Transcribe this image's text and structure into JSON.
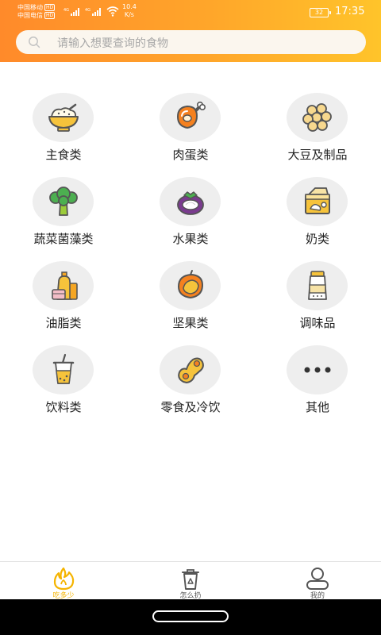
{
  "status_bar": {
    "carrier1": "中国移动",
    "carrier2": "中国电信",
    "hd": "HD",
    "net_type": "4G",
    "speed_value": "10.4",
    "speed_unit": "K/s",
    "battery": "32",
    "time": "17:35"
  },
  "search": {
    "placeholder": "请输入想要查询的食物",
    "icon": "search-icon"
  },
  "categories": [
    {
      "label": "主食类",
      "icon": "rice-bowl-icon"
    },
    {
      "label": "肉蛋类",
      "icon": "chicken-leg-icon"
    },
    {
      "label": "大豆及制品",
      "icon": "soybean-icon"
    },
    {
      "label": "蔬菜菌藻类",
      "icon": "broccoli-icon"
    },
    {
      "label": "水果类",
      "icon": "mangosteen-icon"
    },
    {
      "label": "奶类",
      "icon": "milk-carton-icon"
    },
    {
      "label": "油脂类",
      "icon": "oil-bottle-icon"
    },
    {
      "label": "坚果类",
      "icon": "nut-icon"
    },
    {
      "label": "调味品",
      "icon": "seasoning-jar-icon"
    },
    {
      "label": "饮料类",
      "icon": "drink-cup-icon"
    },
    {
      "label": "零食及冷饮",
      "icon": "peanut-icon"
    },
    {
      "label": "其他",
      "icon": "more-dots-icon"
    }
  ],
  "tabs": [
    {
      "label": "吃多少",
      "icon": "flame-icon",
      "active": true
    },
    {
      "label": "怎么扔",
      "icon": "recycle-bin-icon",
      "active": false
    },
    {
      "label": "我的",
      "icon": "user-icon",
      "active": false
    }
  ],
  "colors": {
    "accent": "#f5b400",
    "header_start": "#ff8a2a",
    "header_end": "#ffc42a",
    "icon_bg": "#eeeeee"
  }
}
